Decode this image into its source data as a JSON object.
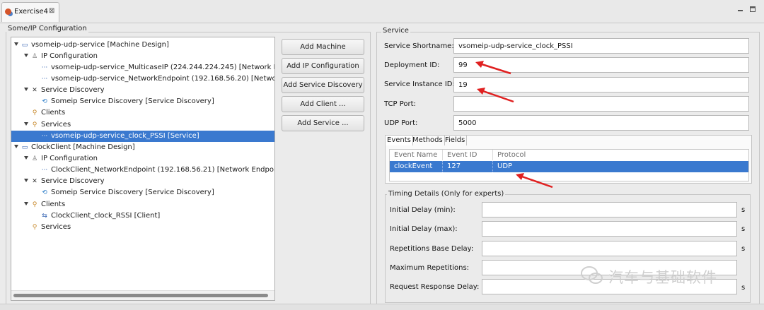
{
  "tab": {
    "title": "Exercise4",
    "close": "⊠"
  },
  "window_controls": {
    "minimize": "▭",
    "maximize": "▭"
  },
  "left_group": {
    "title": "Some/IP Configuration"
  },
  "tree": [
    {
      "label": "vsomeip-udp-service [Machine Design]",
      "icon": "machine-icon",
      "expanded": true
    },
    {
      "label": "IP Configuration",
      "icon": "ip-config-icon",
      "expanded": true
    },
    {
      "label": "vsomeip-udp-service_MulticaseIP (224.244.224.245)  [Network Er",
      "icon": "network-endpoint-icon"
    },
    {
      "label": "vsomeip-udp-service_NetworkEndpoint (192.168.56.20)  [Networ",
      "icon": "network-endpoint-icon"
    },
    {
      "label": "Service Discovery",
      "icon": "service-discovery-icon",
      "expanded": true
    },
    {
      "label": "Someip Service Discovery [Service Discovery]",
      "icon": "someip-sd-icon"
    },
    {
      "label": "Clients",
      "icon": "clients-icon"
    },
    {
      "label": "Services",
      "icon": "services-icon",
      "expanded": true
    },
    {
      "label": "vsomeip-udp-service_clock_PSSI [Service]",
      "icon": "service-item-icon",
      "selected": true
    },
    {
      "label": "ClockClient [Machine Design]",
      "icon": "machine-icon",
      "expanded": true
    },
    {
      "label": "IP Configuration",
      "icon": "ip-config-icon",
      "expanded": true
    },
    {
      "label": "ClockClient_NetworkEndpoint (192.168.56.21)  [Network Endpoin",
      "icon": "network-endpoint-icon"
    },
    {
      "label": "Service Discovery",
      "icon": "service-discovery-icon",
      "expanded": true
    },
    {
      "label": "Someip Service Discovery [Service Discovery]",
      "icon": "someip-sd-icon"
    },
    {
      "label": "Clients",
      "icon": "clients-icon",
      "expanded": true
    },
    {
      "label": "ClockClient_clock_RSSI [Client]",
      "icon": "client-item-icon"
    },
    {
      "label": "Services",
      "icon": "services-icon"
    }
  ],
  "buttons": {
    "add_machine": "Add Machine",
    "add_ip_config": "Add IP Configuration",
    "add_service_discovery": "Add Service Discovery",
    "add_client": "Add Client ...",
    "add_service": "Add Service ..."
  },
  "service_group": {
    "title": "Service"
  },
  "service": {
    "shortname_label": "Service Shortname:",
    "shortname_value": "vsomeip-udp-service_clock_PSSI",
    "deployment_label": "Deployment ID:",
    "deployment_value": "99",
    "instance_label": "Service Instance ID:",
    "instance_value": "19",
    "tcp_label": "TCP Port:",
    "tcp_value": "",
    "udp_label": "UDP Port:",
    "udp_value": "5000"
  },
  "subtabs": [
    "Events",
    "Methods",
    "Fields"
  ],
  "events_table": {
    "headers": [
      "Event Name",
      "Event ID",
      "Protocol"
    ],
    "rows": [
      [
        "clockEvent",
        "127",
        "UDP"
      ]
    ]
  },
  "timing": {
    "title": "Timing Details (Only for experts)",
    "initial_delay_min": "Initial Delay (min):",
    "initial_delay_max": "Initial Delay (max):",
    "rep_base_delay": "Repetitions Base Delay:",
    "max_repetitions": "Maximum Repetitions:",
    "req_resp_delay": "Request Response Delay:",
    "unit": "s"
  },
  "watermark": {
    "text": "汽车与基础软件"
  },
  "colors": {
    "selection": "#3a79cf",
    "arrow": "#e02020"
  }
}
